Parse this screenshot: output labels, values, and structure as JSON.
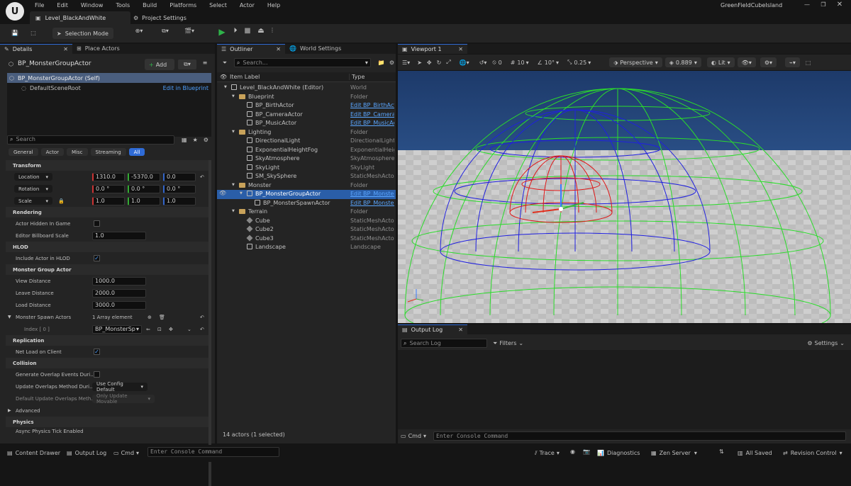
{
  "app": {
    "level_tab": "Level_BlackAndWhite",
    "project_settings": "Project Settings",
    "project_name": "GreenFieldCubeIsland"
  },
  "menu": [
    "File",
    "Edit",
    "Window",
    "Tools",
    "Build",
    "Platforms",
    "Select",
    "Actor",
    "Help"
  ],
  "toolbar": {
    "mode": "Selection Mode"
  },
  "details": {
    "tab": "Details",
    "tab2": "Place Actors",
    "actor_name": "BP_MonsterGroupActor",
    "add_label": "Add",
    "self_label": "BP_MonsterGroupActor (Self)",
    "root_label": "DefaultSceneRoot",
    "edit_bp": "Edit in Blueprint",
    "search_placeholder": "Search",
    "filters": [
      "General",
      "Actor",
      "Misc",
      "Streaming",
      "All"
    ],
    "transform": {
      "title": "Transform",
      "location_label": "Location",
      "rotation_label": "Rotation",
      "scale_label": "Scale",
      "location": [
        "1310.0",
        "-5370.0",
        "0.0"
      ],
      "rotation": [
        "0.0 °",
        "0.0 °",
        "0.0 °"
      ],
      "scale": [
        "1.0",
        "1.0",
        "1.0"
      ]
    },
    "rendering": {
      "title": "Rendering",
      "hidden_label": "Actor Hidden In Game",
      "billboard_label": "Editor Billboard Scale",
      "billboard": "1.0"
    },
    "hlod": {
      "title": "HLOD",
      "include_label": "Include Actor in HLOD"
    },
    "mga": {
      "title": "Monster Group Actor",
      "view_label": "View Distance",
      "view": "1000.0",
      "leave_label": "Leave Distance",
      "leave": "2000.0",
      "load_label": "Load Distance",
      "load": "3000.0",
      "spawn_label": "Monster Spawn Actors",
      "spawn_count": "1 Array element",
      "index_label": "Index [ 0 ]",
      "index_value": "BP_MonsterSp"
    },
    "replication": {
      "title": "Replication",
      "net_label": "Net Load on Client"
    },
    "collision": {
      "title": "Collision",
      "gen_label": "Generate Overlap Events Duri...",
      "upd_label": "Update Overlaps Method Duri...",
      "upd_value": "Use Config Default",
      "def_label": "Default Update Overlaps Meth...",
      "def_value": "Only Update Movable"
    },
    "advanced": "Advanced",
    "physics": {
      "title": "Physics",
      "async_label": "Async Physics Tick Enabled"
    }
  },
  "outliner": {
    "tab": "Outliner",
    "tab2": "World Settings",
    "search_placeholder": "Search...",
    "col_label": "Item Label",
    "col_type": "Type",
    "footer": "14 actors (1 selected)",
    "rows": [
      {
        "label": "Level_BlackAndWhite (Editor)",
        "type": "World",
        "indent": 0,
        "kind": "world"
      },
      {
        "label": "Blueprint",
        "type": "Folder",
        "indent": 1,
        "kind": "folder"
      },
      {
        "label": "BP_BirthActor",
        "type": "Edit BP_BirthActo",
        "indent": 2,
        "kind": "actor",
        "link": true
      },
      {
        "label": "BP_CameraActor",
        "type": "Edit BP_CameraA",
        "indent": 2,
        "kind": "actor",
        "link": true
      },
      {
        "label": "BP_MusicActor",
        "type": "Edit BP_MusicAct",
        "indent": 2,
        "kind": "actor",
        "link": true
      },
      {
        "label": "Lighting",
        "type": "Folder",
        "indent": 1,
        "kind": "folder"
      },
      {
        "label": "DirectionalLight",
        "type": "DirectionalLight",
        "indent": 2,
        "kind": "actor"
      },
      {
        "label": "ExponentialHeightFog",
        "type": "ExponentialHeight",
        "indent": 2,
        "kind": "actor"
      },
      {
        "label": "SkyAtmosphere",
        "type": "SkyAtmosphere",
        "indent": 2,
        "kind": "actor"
      },
      {
        "label": "SkyLight",
        "type": "SkyLight",
        "indent": 2,
        "kind": "actor"
      },
      {
        "label": "SM_SkySphere",
        "type": "StaticMeshActor",
        "indent": 2,
        "kind": "actor"
      },
      {
        "label": "Monster",
        "type": "Folder",
        "indent": 1,
        "kind": "folder"
      },
      {
        "label": "BP_MonsterGroupActor",
        "type": "Edit BP_MonsterG",
        "indent": 2,
        "kind": "actor",
        "link": true,
        "selected": true
      },
      {
        "label": "BP_MonsterSpawnActor",
        "type": "Edit BP_MonsterS",
        "indent": 3,
        "kind": "actor",
        "link": true
      },
      {
        "label": "Terrain",
        "type": "Folder",
        "indent": 1,
        "kind": "folder"
      },
      {
        "label": "Cube",
        "type": "StaticMeshActor",
        "indent": 2,
        "kind": "cube"
      },
      {
        "label": "Cube2",
        "type": "StaticMeshActor",
        "indent": 2,
        "kind": "cube"
      },
      {
        "label": "Cube3",
        "type": "StaticMeshActor",
        "indent": 2,
        "kind": "cube"
      },
      {
        "label": "Landscape",
        "type": "Landscape",
        "indent": 2,
        "kind": "actor"
      }
    ]
  },
  "viewport": {
    "tab": "Viewport 1",
    "snap_rot": "0",
    "grid": "10",
    "rot": "10°",
    "scale": "0.25",
    "persp": "Perspective",
    "fov": "0.889",
    "lit": "Lit"
  },
  "outputlog": {
    "tab": "Output Log",
    "search_placeholder": "Search Log",
    "filters": "Filters",
    "settings": "Settings",
    "cmd": "Cmd",
    "console_placeholder": "Enter Console Command"
  },
  "statusbar": {
    "content_drawer": "Content Drawer",
    "output_log": "Output Log",
    "cmd": "Cmd",
    "console_placeholder": "Enter Console Command",
    "trace": "Trace",
    "diagnostics": "Diagnostics",
    "zen": "Zen Server",
    "saved": "All Saved",
    "revision": "Revision Control"
  }
}
